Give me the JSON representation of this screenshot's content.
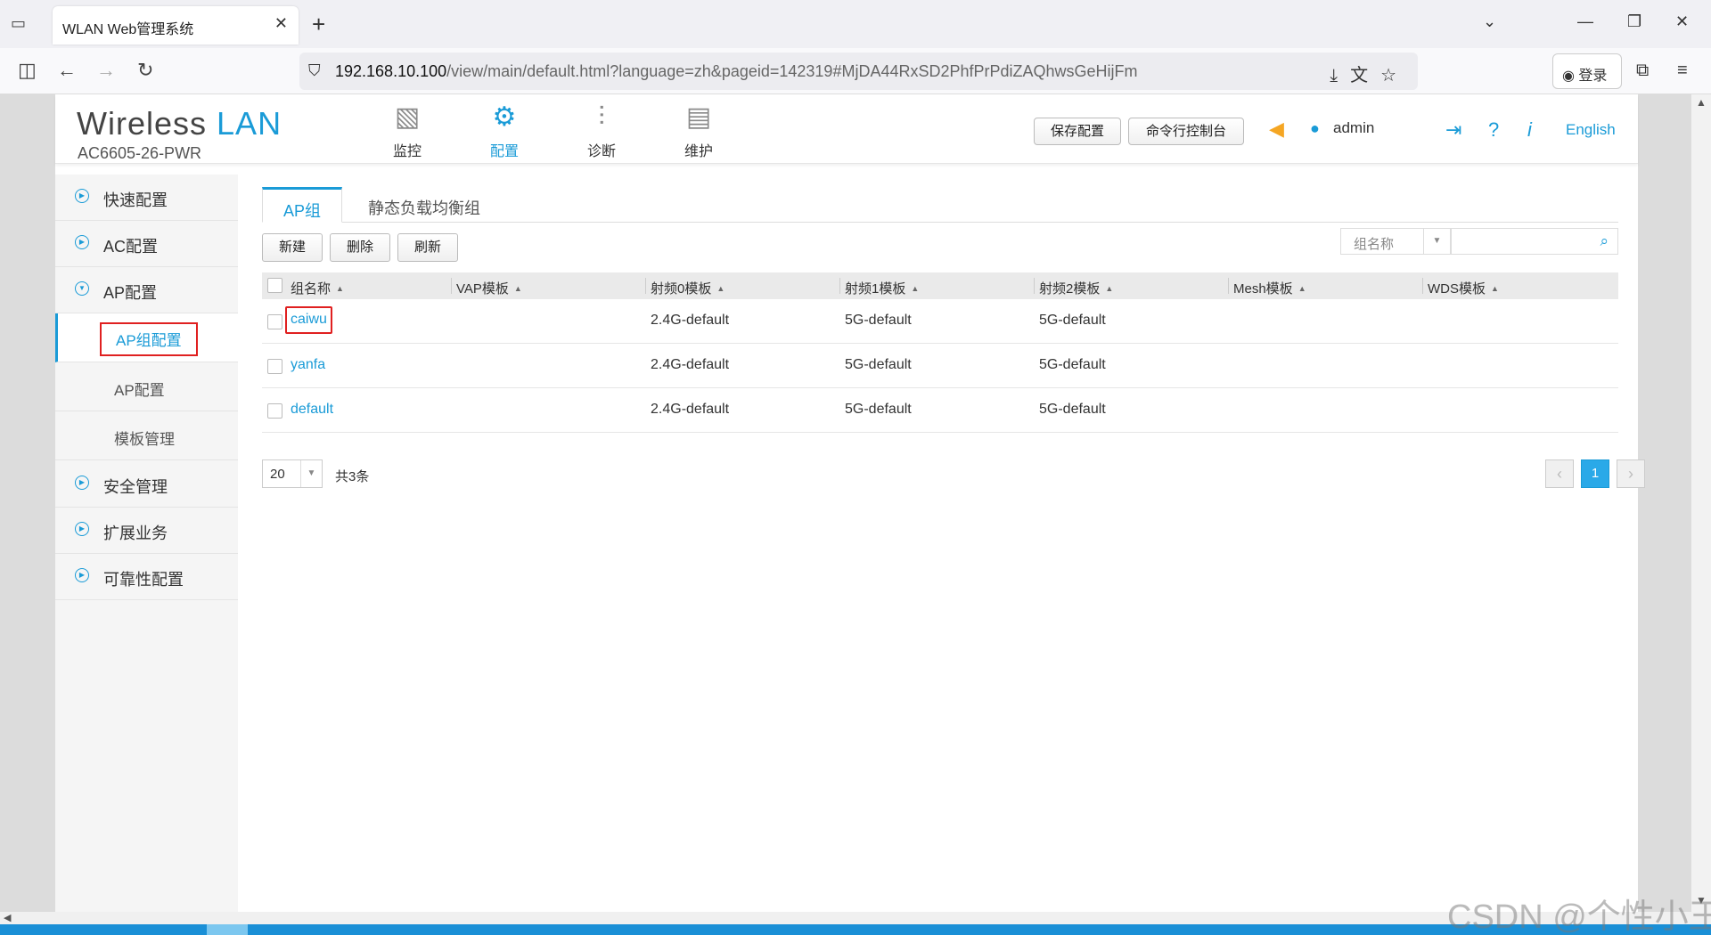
{
  "browser": {
    "tab_title": "WLAN Web管理系统",
    "url_host": "192.168.10.100",
    "url_path": "/view/main/default.html?language=zh&pageid=142319#MjDA44RxSD2PhfPrPdiZAQhwsGeHijFm",
    "login_label": "登录"
  },
  "header": {
    "logo_word1": "Wireless",
    "logo_word2": "LAN",
    "model": "AC6605-26-PWR",
    "modules": [
      {
        "label": "监控",
        "icon": "monitor-icon"
      },
      {
        "label": "配置",
        "icon": "gear-icon",
        "active": true
      },
      {
        "label": "诊断",
        "icon": "sliders-icon"
      },
      {
        "label": "维护",
        "icon": "maintenance-icon"
      }
    ],
    "save_label": "保存配置",
    "cli_label": "命令行控制台",
    "user": "admin",
    "lang_label": "English"
  },
  "sidebar": {
    "items": [
      {
        "label": "快速配置",
        "level": 1
      },
      {
        "label": "AC配置",
        "level": 1
      },
      {
        "label": "AP配置",
        "level": 1,
        "expanded": true
      },
      {
        "label": "AP组配置",
        "level": 2,
        "active": true
      },
      {
        "label": "AP配置",
        "level": 2
      },
      {
        "label": "模板管理",
        "level": 2
      },
      {
        "label": "安全管理",
        "level": 1
      },
      {
        "label": "扩展业务",
        "level": 1
      },
      {
        "label": "可靠性配置",
        "level": 1
      }
    ]
  },
  "content": {
    "tabs": [
      "AP组",
      "静态负载均衡组"
    ],
    "toolbar": {
      "new_label": "新建",
      "delete_label": "删除",
      "refresh_label": "刷新"
    },
    "search": {
      "field": "组名称",
      "value": ""
    },
    "table": {
      "columns": [
        "组名称",
        "VAP模板",
        "射频0模板",
        "射频1模板",
        "射频2模板",
        "Mesh模板",
        "WDS模板"
      ],
      "rows": [
        [
          "caiwu",
          "",
          "2.4G-default",
          "5G-default",
          "5G-default",
          "",
          ""
        ],
        [
          "yanfa",
          "",
          "2.4G-default",
          "5G-default",
          "5G-default",
          "",
          ""
        ],
        [
          "default",
          "",
          "2.4G-default",
          "5G-default",
          "5G-default",
          "",
          ""
        ]
      ]
    },
    "pager": {
      "page_size": "20",
      "total": "共3条",
      "current_page": "1"
    }
  },
  "watermark": "CSDN @个性小王"
}
